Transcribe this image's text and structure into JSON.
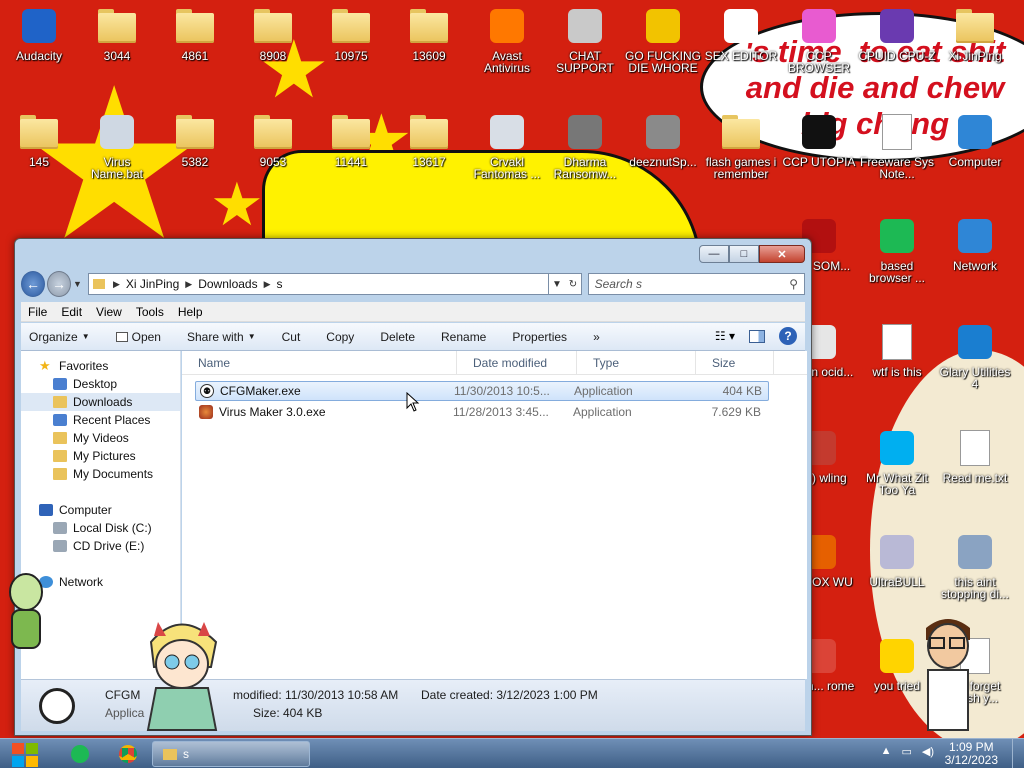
{
  "wallpaper": {
    "bubble_text": "'s time  to eat shit\nand die and chew\nbig chung"
  },
  "desktop_icons": [
    {
      "label": "Audacity",
      "icon": "audacity-icon",
      "kind": "app",
      "color": "#1f63c8"
    },
    {
      "label": "3044",
      "icon": "folder-icon",
      "kind": "folder"
    },
    {
      "label": "4861",
      "icon": "folder-icon",
      "kind": "folder"
    },
    {
      "label": "8908",
      "icon": "folder-icon",
      "kind": "folder"
    },
    {
      "label": "10975",
      "icon": "folder-icon",
      "kind": "folder"
    },
    {
      "label": "13609",
      "icon": "folder-icon",
      "kind": "folder"
    },
    {
      "label": "Avast Antivirus",
      "icon": "avast-icon",
      "kind": "app",
      "color": "#ff7800"
    },
    {
      "label": "CHAT SUPPORT",
      "icon": "chat-support-icon",
      "kind": "app",
      "color": "#c9c9c9"
    },
    {
      "label": "GO FUCKING DIE WHORE",
      "icon": "de-logo-icon",
      "kind": "app",
      "color": "#f2c300"
    },
    {
      "label": "SEX EDITOR",
      "icon": "hxd-icon",
      "kind": "app",
      "color": "#ffffff"
    },
    {
      "label": "CCP BROWSER",
      "icon": "browser-icon",
      "kind": "app",
      "color": "#e85bd0"
    },
    {
      "label": "CPUID CPU-Z",
      "icon": "cpuz-icon",
      "kind": "app",
      "color": "#6a3ab0"
    },
    {
      "label": "Xi JinPing",
      "icon": "user-folder-icon",
      "kind": "folder"
    },
    {
      "label": "145",
      "icon": "folder-icon",
      "kind": "folder"
    },
    {
      "label": "Virus Name.bat",
      "icon": "batch-file-icon",
      "kind": "app",
      "color": "#cfd8e3"
    },
    {
      "label": "5382",
      "icon": "folder-icon",
      "kind": "folder"
    },
    {
      "label": "9053",
      "icon": "folder-icon",
      "kind": "folder"
    },
    {
      "label": "11441",
      "icon": "folder-icon",
      "kind": "folder"
    },
    {
      "label": "13617",
      "icon": "folder-icon",
      "kind": "folder"
    },
    {
      "label": "Crvakl Fantomas ...",
      "icon": "window-app-icon",
      "kind": "app",
      "color": "#d8dee6"
    },
    {
      "label": "Dharma Ransomw...",
      "icon": "skull-icon",
      "kind": "app",
      "color": "#777777"
    },
    {
      "label": "deeznutSp...",
      "icon": "copy-icon",
      "kind": "app",
      "color": "#8a8a8a"
    },
    {
      "label": "flash games i remember",
      "icon": "zip-folder-icon",
      "kind": "folder"
    },
    {
      "label": "CCP UTOPIA",
      "icon": "utopia-icon",
      "kind": "app",
      "color": "#111111"
    },
    {
      "label": "Freeware Sys Note...",
      "icon": "doc-icon",
      "kind": "doc"
    },
    {
      "label": "Computer",
      "icon": "computer-icon",
      "kind": "app",
      "color": "#2f86d6"
    },
    {
      "label": "TYA SOM...",
      "icon": "skull-crossbones-icon",
      "kind": "app",
      "color": "#b21010"
    },
    {
      "label": "based browser ...",
      "icon": "spotify-icon",
      "kind": "app",
      "color": "#1db954"
    },
    {
      "label": "Network",
      "icon": "network-icon",
      "kind": "app",
      "color": "#2f86d6"
    },
    {
      "label": "andan ocid...",
      "icon": "troll-icon",
      "kind": "app",
      "color": "#e6e6e6"
    },
    {
      "label": "wtf is this",
      "icon": "calendar-doc-icon",
      "kind": "doc"
    },
    {
      "label": "Glary Utilities 4",
      "icon": "glary-icon",
      "kind": "app",
      "color": "#1a7ed0"
    },
    {
      "label": "ey))) wling",
      "icon": "santa-icon",
      "kind": "app",
      "color": "#c43a2e"
    },
    {
      "label": "Mr What Zit Too Ya",
      "icon": "skype-icon",
      "kind": "app",
      "color": "#00aff0"
    },
    {
      "label": "Read me.txt",
      "icon": "text-file-icon",
      "kind": "doc"
    },
    {
      "label": "RY FOX WU",
      "icon": "firefox-icon",
      "kind": "app",
      "color": "#e66000"
    },
    {
      "label": "UltraBULL",
      "icon": "disc-icon",
      "kind": "app",
      "color": "#b9b9d6"
    },
    {
      "label": "this aint stopping di...",
      "icon": "installer-icon",
      "kind": "app",
      "color": "#8aa3c2"
    },
    {
      "label": "mmm... rome",
      "icon": "chrome-icon",
      "kind": "app",
      "color": "#db4437"
    },
    {
      "label": "you tried",
      "icon": "gold-star-icon",
      "kind": "app",
      "color": "#ffd400"
    },
    {
      "label": "ont forget wash y...",
      "icon": "calendar-doc-icon",
      "kind": "doc"
    }
  ],
  "window": {
    "caption": {
      "minimize": "—",
      "maximize": "□",
      "close": "✕"
    },
    "breadcrumbs": [
      "Xi JinPing",
      "Downloads",
      "s"
    ],
    "search_placeholder": "Search s",
    "menu": [
      "File",
      "Edit",
      "View",
      "Tools",
      "Help"
    ],
    "commands": [
      {
        "label": "Organize",
        "dropdown": true
      },
      {
        "label": "Open",
        "dropdown": false
      },
      {
        "label": "Share with",
        "dropdown": true
      },
      {
        "label": "Cut",
        "dropdown": false
      },
      {
        "label": "Copy",
        "dropdown": false
      },
      {
        "label": "Delete",
        "dropdown": false
      },
      {
        "label": "Rename",
        "dropdown": false
      },
      {
        "label": "Properties",
        "dropdown": false
      }
    ],
    "more": "»",
    "nav": {
      "favorites": "Favorites",
      "favorite_items": [
        "Desktop",
        "Downloads",
        "Recent Places",
        "My Videos",
        "My Pictures",
        "My Documents"
      ],
      "computer": "Computer",
      "computer_items": [
        "Local Disk (C:)",
        "CD Drive (E:)"
      ],
      "network": "Network"
    },
    "columns": {
      "name": "Name",
      "date": "Date modified",
      "type": "Type",
      "size": "Size"
    },
    "files": [
      {
        "name": "CFGMaker.exe",
        "date": "11/30/2013 10:5...",
        "type": "Application",
        "size": "404 KB",
        "selected": true
      },
      {
        "name": "Virus Maker 3.0.exe",
        "date": "11/28/2013 3:45...",
        "type": "Application",
        "size": "7.629 KB",
        "selected": false
      }
    ],
    "details": {
      "name": "CFGM",
      "type": "Applica",
      "modified": "modified: 11/30/2013 10:58 AM",
      "created": "Date created: 3/12/2023 1:00 PM",
      "size": "Size: 404 KB"
    }
  },
  "taskbar": {
    "folder_label": "s",
    "time": "1:09 PM",
    "date": "3/12/2023",
    "tray_up": "▲"
  }
}
